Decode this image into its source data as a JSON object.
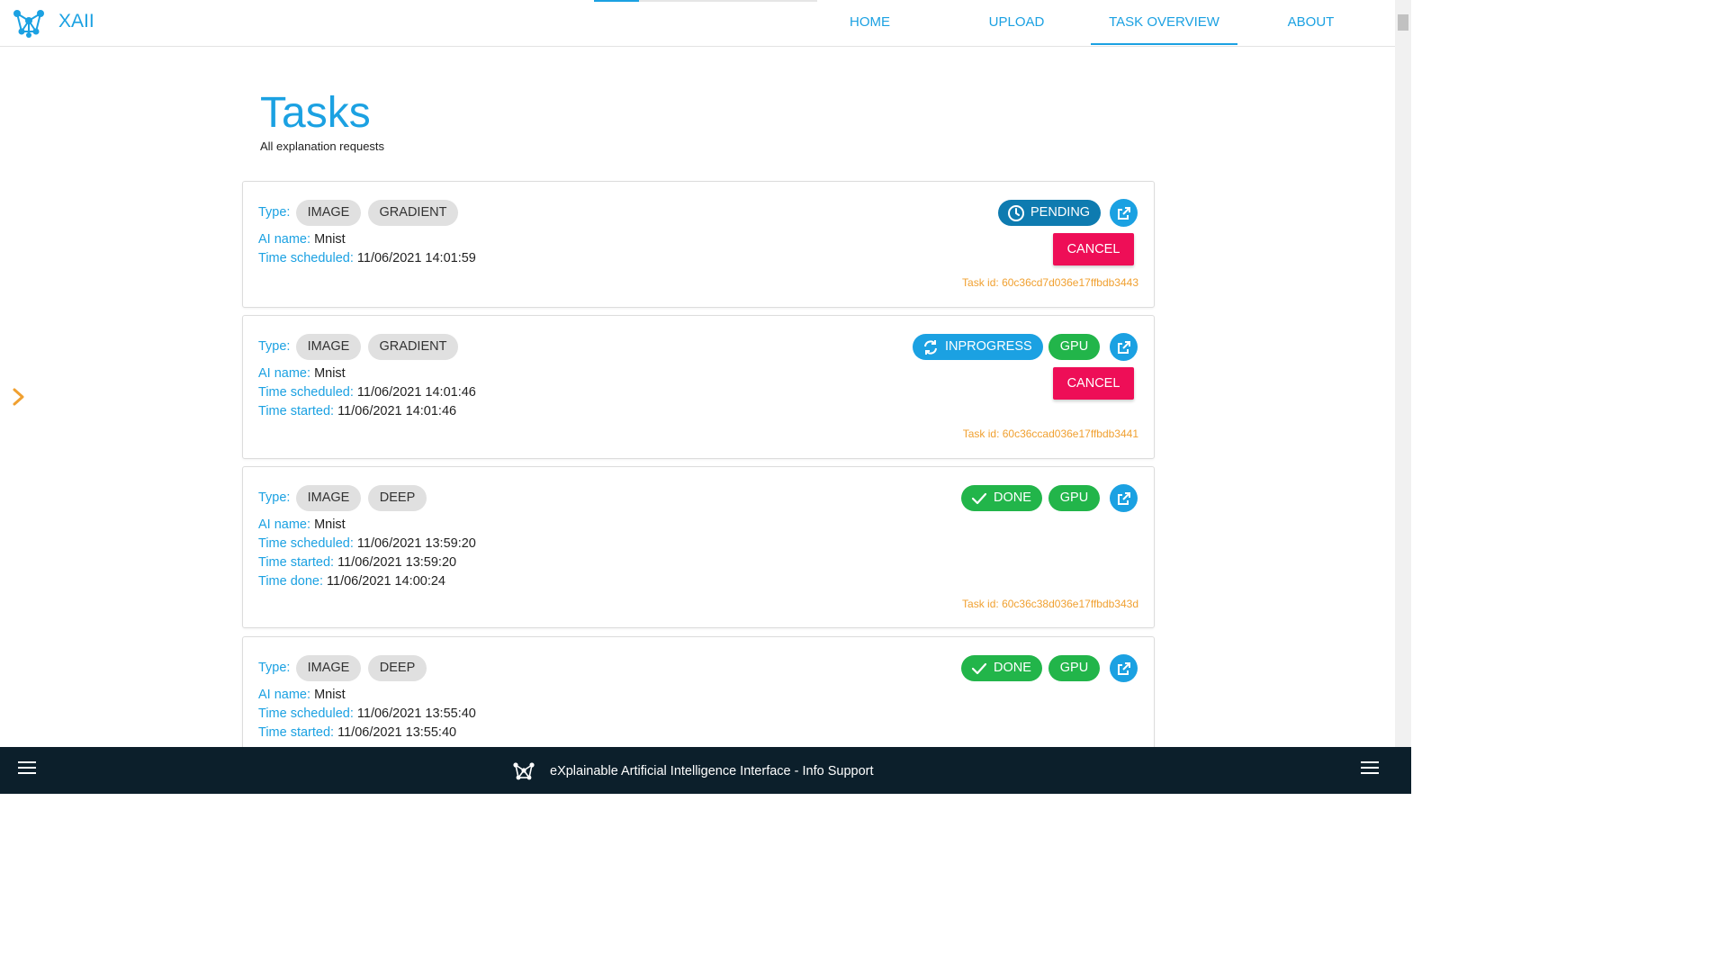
{
  "app": {
    "brand": "XAII",
    "accent_color": "#1ba1e2"
  },
  "nav": {
    "items": [
      {
        "label": "HOME"
      },
      {
        "label": "UPLOAD"
      },
      {
        "label": "TASK OVERVIEW"
      },
      {
        "label": "ABOUT"
      }
    ],
    "active": "TASK OVERVIEW",
    "loading_progress": 0.2
  },
  "header": {
    "title": "Tasks",
    "subtitle": "All explanation requests"
  },
  "labels": {
    "type": "Type:",
    "ai_name": "AI name:",
    "time_scheduled": "Time scheduled:",
    "time_started": "Time started:",
    "time_done": "Time done:",
    "cancel": "CANCEL",
    "gpu": "GPU"
  },
  "tasks": [
    {
      "type_chips": [
        "IMAGE",
        "GRADIENT"
      ],
      "ai_name": "Mnist",
      "time_scheduled": "11/06/2021 14:01:59",
      "status": "PENDING",
      "task_id": "Task id: 60c36cd7d036e17ffbdb3443"
    },
    {
      "type_chips": [
        "IMAGE",
        "GRADIENT"
      ],
      "ai_name": "Mnist",
      "time_scheduled": "11/06/2021 14:01:46",
      "time_started": "11/06/2021 14:01:46",
      "status": "INPROGRESS",
      "task_id": "Task id: 60c36ccad036e17ffbdb3441"
    },
    {
      "type_chips": [
        "IMAGE",
        "DEEP"
      ],
      "ai_name": "Mnist",
      "time_scheduled": "11/06/2021 13:59:20",
      "time_started": "11/06/2021 13:59:20",
      "time_done": "11/06/2021 14:00:24",
      "status": "DONE",
      "task_id": "Task id: 60c36c38d036e17ffbdb343d"
    },
    {
      "type_chips": [
        "IMAGE",
        "DEEP"
      ],
      "ai_name": "Mnist",
      "time_scheduled": "11/06/2021 13:55:40",
      "time_started": "11/06/2021 13:55:40",
      "status": "DONE"
    }
  ],
  "status_colors": {
    "pending": "#0e7bb0",
    "inprogress": "#1ba1e2",
    "done": "#22b54a",
    "cancel": "#ee0e57"
  },
  "icons": {
    "logo": "network-logo-icon",
    "pending": "clock-icon",
    "inprogress": "sync-icon",
    "done": "check-icon",
    "open": "open-external-icon",
    "side_toggle": "chevron-right-icon",
    "menu": "hamburger-menu-icon"
  },
  "footer": {
    "text": "eXplainable Artificial Intelligence Interface - Info Support"
  }
}
